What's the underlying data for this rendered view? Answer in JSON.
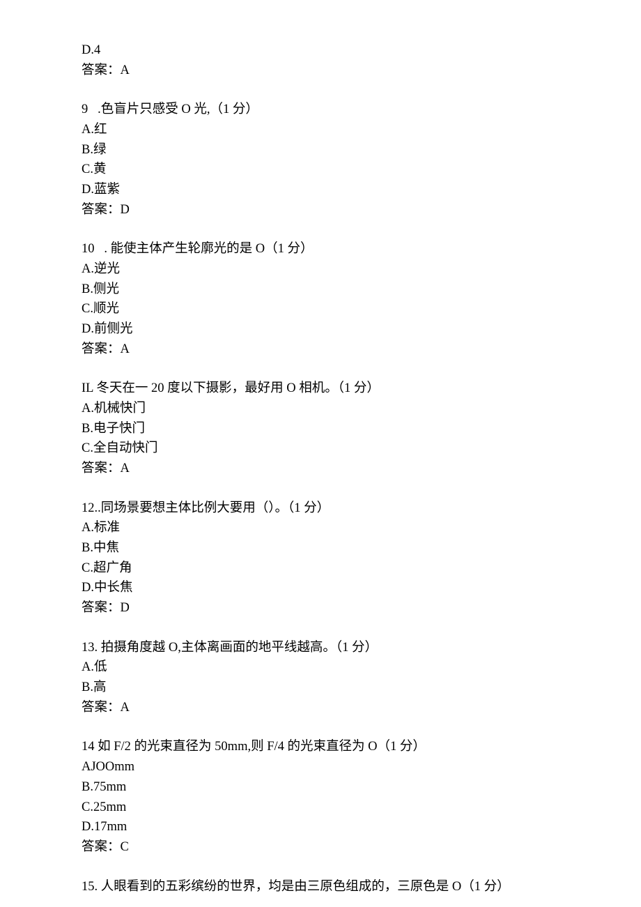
{
  "q8_tail": {
    "optD": "D.4",
    "answer": "答案：A"
  },
  "q9": {
    "stem": "9   .色盲片只感受 O 光,（1 分）",
    "optA": "A.红",
    "optB": "B.绿",
    "optC": "C.黄",
    "optD": "D.蓝紫",
    "answer": "答案：D"
  },
  "q10": {
    "stem": "10   . 能使主体产生轮廓光的是 O（1 分）",
    "optA": "A.逆光",
    "optB": "B.侧光",
    "optC": "C.顺光",
    "optD": "D.前侧光",
    "answer": "答案：A"
  },
  "q11": {
    "stem": "IL 冬天在一 20 度以下摄影，最好用 O 相机。（1 分）",
    "optA": "A.机械快门",
    "optB": "B.电子快门",
    "optC": "C.全自动快门",
    "answer": "答案：A"
  },
  "q12": {
    "stem": "12..同场景要想主体比例大要用（）。（1 分）",
    "optA": "A.标准",
    "optB": "B.中焦",
    "optC": "C.超广角",
    "optD": "D.中长焦",
    "answer": "答案：D"
  },
  "q13": {
    "stem": "13. 拍摄角度越 O,主体离画面的地平线越高。（1 分）",
    "optA": "A.低",
    "optB": "B.高",
    "answer": "答案：A"
  },
  "q14": {
    "stem": "14 如 F/2 的光束直径为 50mm,则 F/4 的光束直径为 O（1 分）",
    "optA": "AJOOmm",
    "optB": "B.75mm",
    "optC": "C.25mm",
    "optD": "D.17mm",
    "answer": "答案：C"
  },
  "q15": {
    "stem": "15. 人眼看到的五彩缤纷的世界，均是由三原色组成的，三原色是 O（1 分）"
  }
}
